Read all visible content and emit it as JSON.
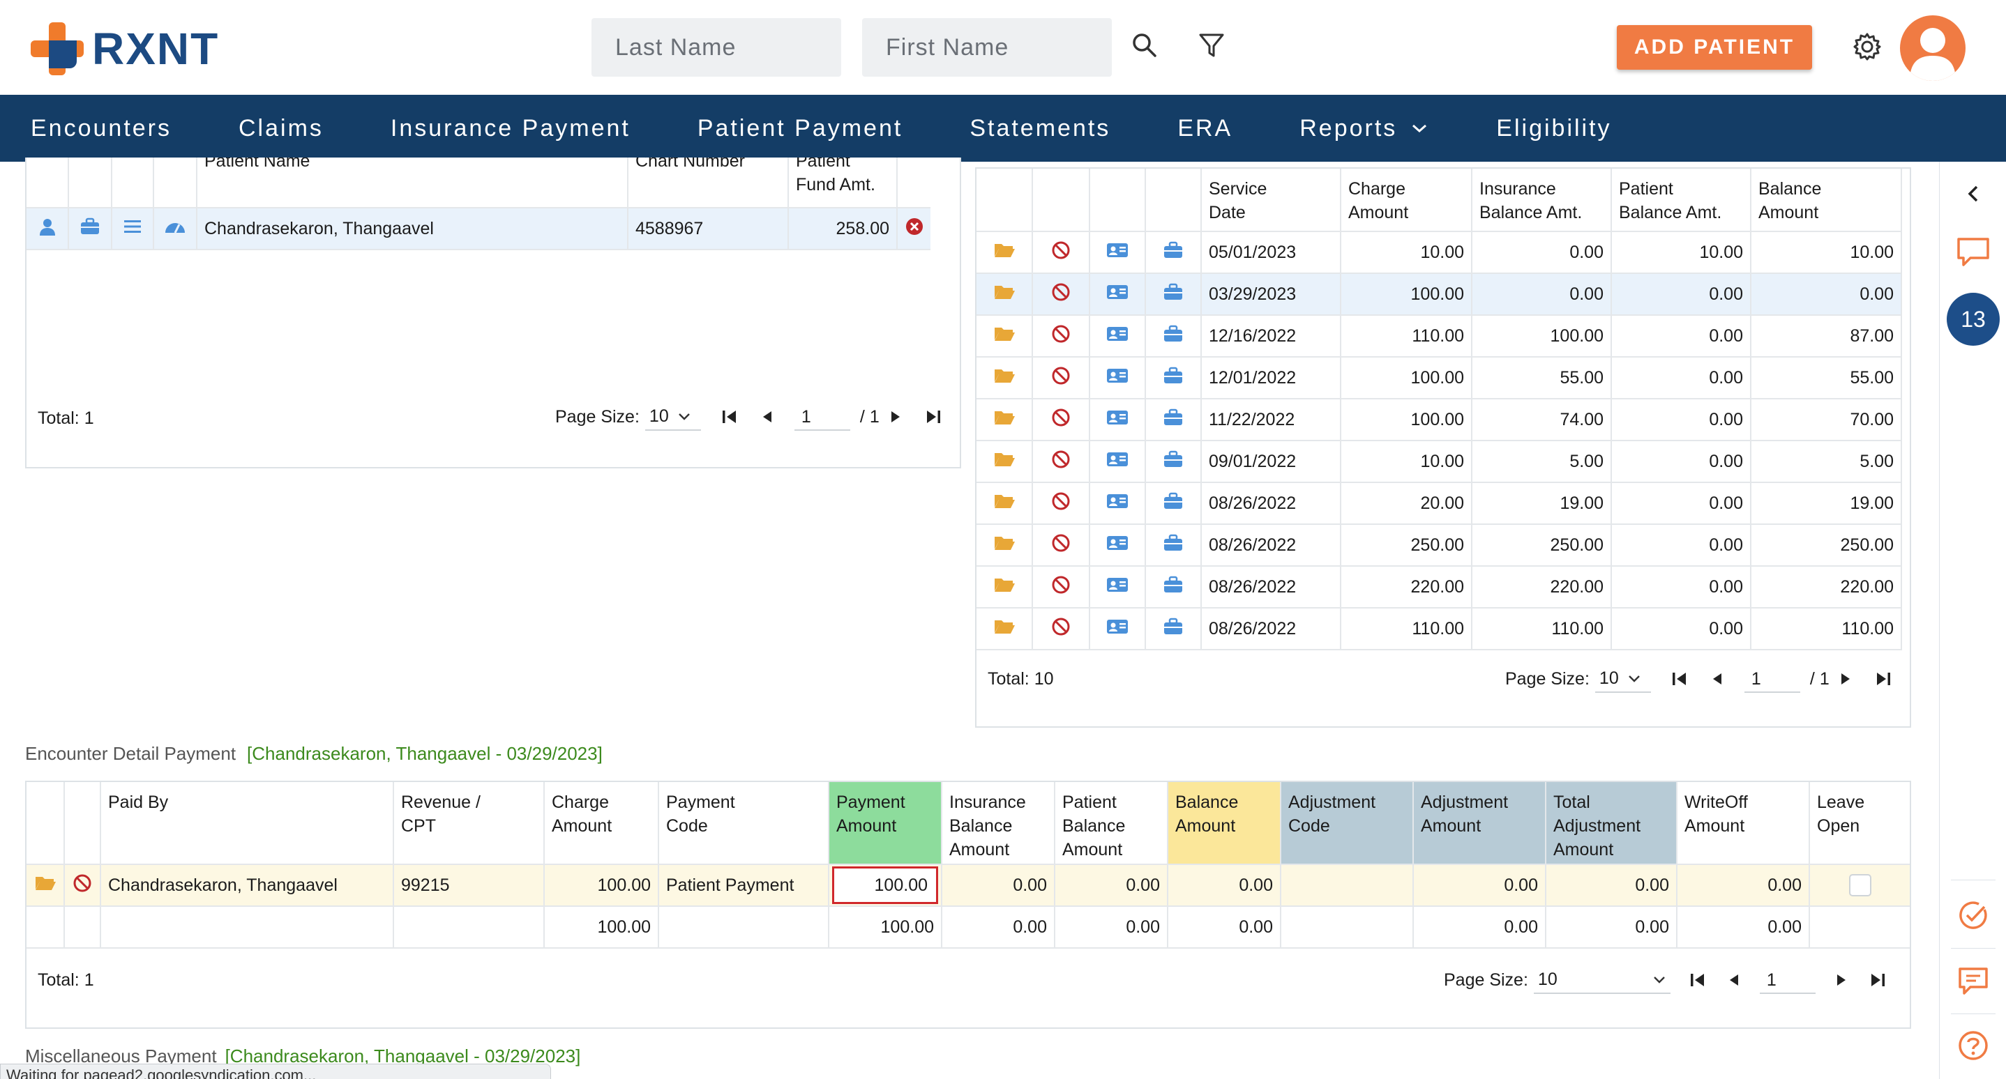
{
  "brand": {
    "name": "RXNT"
  },
  "search": {
    "last_name_placeholder": "Last Name",
    "first_name_placeholder": "First Name"
  },
  "header": {
    "add_patient_label": "ADD PATIENT"
  },
  "nav": {
    "items": [
      "Encounters",
      "Claims",
      "Insurance Payment",
      "Patient Payment",
      "Statements",
      "ERA",
      "Reports",
      "Eligibility"
    ]
  },
  "rail": {
    "badge_count": "13"
  },
  "patient_grid": {
    "headers": {
      "patient_name": "Patient Name",
      "chart_number": "Chart Number",
      "fund_amt": "Patient Fund Amt."
    },
    "row": {
      "name": "Chandrasekaron, Thangaavel",
      "chart": "4588967",
      "fund": "258.00"
    },
    "total": "Total: 1",
    "page_size_label": "Page Size:",
    "page_size": "10",
    "page": "1",
    "page_of": "/ 1"
  },
  "encounter_grid": {
    "headers": {
      "service_date": "Service Date",
      "charge_amount": "Charge Amount",
      "insurance_balance": "Insurance Balance Amt.",
      "patient_balance": "Patient Balance Amt.",
      "balance_amount": "Balance Amount"
    },
    "rows": [
      [
        "05/01/2023",
        "10.00",
        "0.00",
        "10.00",
        "10.00"
      ],
      [
        "03/29/2023",
        "100.00",
        "0.00",
        "0.00",
        "0.00"
      ],
      [
        "12/16/2022",
        "110.00",
        "100.00",
        "0.00",
        "87.00"
      ],
      [
        "12/01/2022",
        "100.00",
        "55.00",
        "0.00",
        "55.00"
      ],
      [
        "11/22/2022",
        "100.00",
        "74.00",
        "0.00",
        "70.00"
      ],
      [
        "09/01/2022",
        "10.00",
        "5.00",
        "0.00",
        "5.00"
      ],
      [
        "08/26/2022",
        "20.00",
        "19.00",
        "0.00",
        "19.00"
      ],
      [
        "08/26/2022",
        "250.00",
        "250.00",
        "0.00",
        "250.00"
      ],
      [
        "08/26/2022",
        "220.00",
        "220.00",
        "0.00",
        "220.00"
      ],
      [
        "08/26/2022",
        "110.00",
        "110.00",
        "0.00",
        "110.00"
      ]
    ],
    "total": "Total: 10",
    "page_size_label": "Page Size:",
    "page_size": "10",
    "page": "1",
    "page_of": "/ 1"
  },
  "detail": {
    "title": "Encounter Detail Payment",
    "context": "[Chandrasekaron, Thangaavel - 03/29/2023]",
    "headers": {
      "paid_by": "Paid By",
      "revenue_cpt": "Revenue / CPT",
      "charge_amount": "Charge Amount",
      "payment_code": "Payment Code",
      "payment_amount": "Payment Amount",
      "insurance_balance": "Insurance Balance Amount",
      "patient_balance": "Patient Balance Amount",
      "balance_amount": "Balance Amount",
      "adjustment_code": "Adjustment Code",
      "adjustment_amount": "Adjustment Amount",
      "total_adjustment": "Total Adjustment Amount",
      "writeoff_amount": "WriteOff Amount",
      "leave_open": "Leave Open"
    },
    "row": {
      "paid_by": "Chandrasekaron, Thangaavel",
      "cpt": "99215",
      "charge": "100.00",
      "payment_code": "Patient Payment",
      "payment_amount": "100.00",
      "insurance_balance": "0.00",
      "patient_balance": "0.00",
      "balance": "0.00",
      "adjustment_code": "",
      "adjustment_amount": "0.00",
      "total_adjustment": "0.00",
      "writeoff": "0.00"
    },
    "totals": {
      "charge": "100.00",
      "payment_amount": "100.00",
      "insurance_balance": "0.00",
      "patient_balance": "0.00",
      "balance": "0.00",
      "adjustment_amount": "0.00",
      "total_adjustment": "0.00",
      "writeoff": "0.00"
    },
    "total": "Total: 1",
    "page_size_label": "Page Size:",
    "page_size": "10",
    "page": "1"
  },
  "misc": {
    "title": "Miscellaneous Payment",
    "context": "[Chandrasekaron, Thangaavel - 03/29/2023]"
  },
  "status_bar": {
    "text": "Waiting for pagead2.googlesyndication.com..."
  },
  "colors": {
    "brand_orange": "#f07b2b",
    "brand_blue": "#1c4a82",
    "nav_bg": "#143d66",
    "payment_header": "#8ddc9c",
    "balance_header": "#fbe79a",
    "adjustment_header": "#b7cbd6",
    "selected_row": "#e9f2fb",
    "detail_row": "#fdf8e3",
    "icon_folder": "#e8a737",
    "icon_blue": "#4a90d9",
    "icon_red": "#c0282b"
  }
}
